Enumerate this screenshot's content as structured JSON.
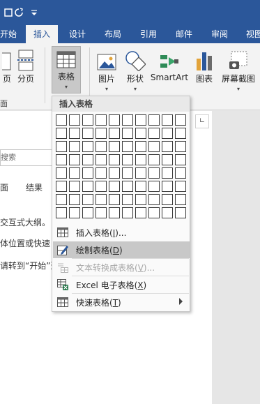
{
  "tabs": {
    "home": "开始",
    "insert": "插入",
    "design": "设计",
    "layout": "布局",
    "references": "引用",
    "mailings": "邮件",
    "review": "审阅",
    "view": "视图"
  },
  "ribbon": {
    "page_label": "页",
    "page_break": "分页",
    "table": "表格",
    "pictures": "图片",
    "shapes": "形状",
    "smartart": "SmartArt",
    "chart": "图表",
    "screenshot": "屏幕截图",
    "group_pages": "面"
  },
  "nav": {
    "search_placeholder": "搜索",
    "tab_pages": "面",
    "tab_results": "结果"
  },
  "doc_lines": [
    "交互式大纲。",
    "体位置或快速",
    "请转到“开始”选"
  ],
  "menu": {
    "title": "插入表格",
    "grid_rows": 8,
    "grid_cols": 10,
    "items": [
      {
        "label": "插入表格(I)...",
        "text": "插入表格",
        "key": "I",
        "tail": "...",
        "state": "normal",
        "icon": "table-grid-icon"
      },
      {
        "label": "绘制表格(D)",
        "text": "绘制表格",
        "key": "D",
        "tail": "",
        "state": "highlighted",
        "icon": "pencil-table-icon"
      },
      {
        "label": "文本转换成表格(V)...",
        "text": "文本转换成表格",
        "key": "V",
        "tail": "...",
        "state": "disabled",
        "icon": "text-to-table-icon"
      },
      {
        "label": "Excel 电子表格(X)",
        "text": "Excel 电子表格",
        "key": "X",
        "tail": "",
        "state": "normal",
        "icon": "excel-sheet-icon"
      },
      {
        "label": "快速表格(T)",
        "text": "快速表格",
        "key": "T",
        "tail": "",
        "state": "normal",
        "icon": "quick-table-icon",
        "submenu": true
      }
    ]
  },
  "colors": {
    "accent": "#2b579a",
    "highlight": "#c8c8c8",
    "excel_green": "#217346"
  }
}
